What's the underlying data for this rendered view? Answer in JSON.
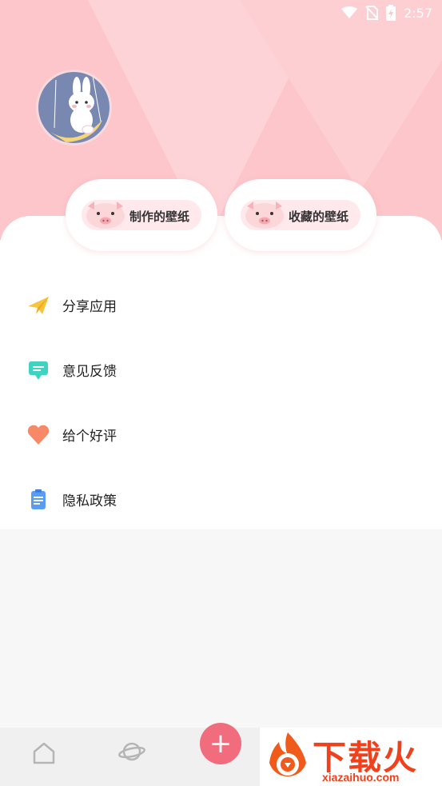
{
  "status_bar": {
    "time": "2:57"
  },
  "profile": {
    "avatar_alt": ""
  },
  "quick_actions": [
    {
      "label": "制作的壁纸"
    },
    {
      "label": "收藏的壁纸"
    }
  ],
  "menu": [
    {
      "label": "分享应用",
      "icon": "paper-plane-icon"
    },
    {
      "label": "意见反馈",
      "icon": "chat-bubble-icon"
    },
    {
      "label": "给个好评",
      "icon": "heart-icon"
    },
    {
      "label": "隐私政策",
      "icon": "clipboard-icon"
    }
  ],
  "tabbar": {
    "fab_symbol": "+"
  },
  "watermark": {
    "title": "下载火",
    "url": "xiazaihuo.com"
  },
  "colors": {
    "header": "#fcc6cb",
    "accent": "#f16c7c"
  }
}
